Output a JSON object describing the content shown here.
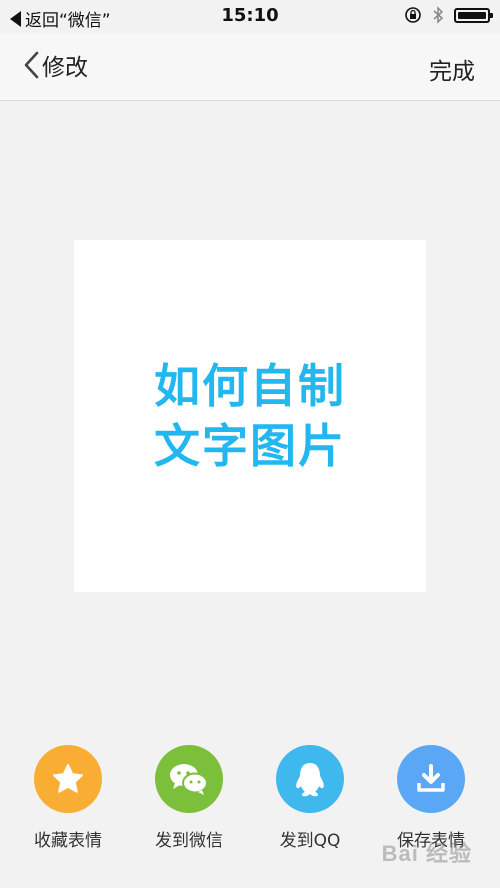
{
  "status_bar": {
    "back_text": "返回“微信”",
    "time": "15:10"
  },
  "nav": {
    "title": "修改",
    "done_label": "完成"
  },
  "preview": {
    "lines": [
      "如何自制",
      "文字图片"
    ],
    "text_color": "#22b7ee"
  },
  "actions": [
    {
      "label": "收藏表情",
      "icon": "star-icon",
      "color": "#f9ad32"
    },
    {
      "label": "发到微信",
      "icon": "wechat-icon",
      "color": "#7bbf3a"
    },
    {
      "label": "发到QQ",
      "icon": "qq-penguin-icon",
      "color": "#3fb9ed"
    },
    {
      "label": "保存表情",
      "icon": "download-icon",
      "color": "#5aa8f5"
    }
  ],
  "watermark": "Bai 经验"
}
